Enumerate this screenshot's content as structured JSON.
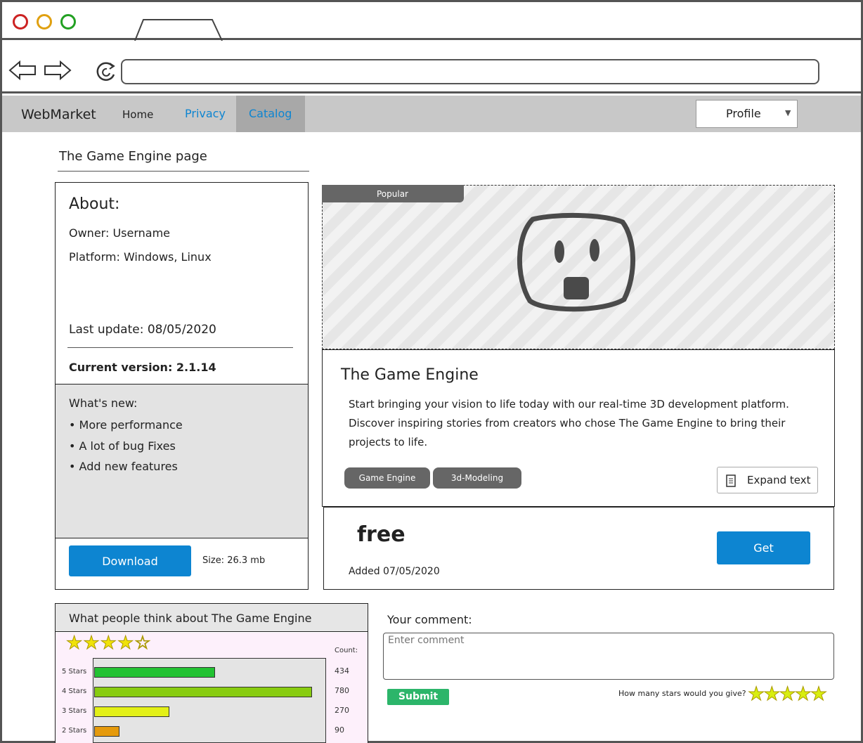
{
  "nav": {
    "brand": "WebMarket",
    "home": "Home",
    "privacy": "Privacy",
    "catalog": "Catalog",
    "profile": "Profile"
  },
  "page": {
    "heading": "The Game Engine page"
  },
  "about": {
    "title": "About:",
    "owner": "Owner: Username",
    "platform": "Platform: Windows, Linux",
    "last_update": "Last update: 08/05/2020",
    "current_version": "Current version: 2.1.14",
    "whats_new_title": "What's new:",
    "whats_new": [
      "• More performance",
      "• A lot of bug Fixes",
      "• Add new features"
    ],
    "download_label": "Download",
    "size": "Size: 26.3 mb"
  },
  "product": {
    "badge": "Popular",
    "title": "The Game Engine",
    "description": [
      "Start bringing your vision to life today with our real-time 3D development platform.",
      "Discover inspiring stories from creators who chose The Game Engine to bring their",
      "projects to life."
    ],
    "tags": [
      "Game Engine",
      "3d-Modeling"
    ],
    "expand_label": "Expand text",
    "price": "free",
    "added": "Added 07/05/2020",
    "get_label": "Get"
  },
  "reviews": {
    "title": "What people think about The Game Engine",
    "average_stars": 4,
    "count_header": "Count:",
    "rows": [
      {
        "label": "5 Stars",
        "count": 434,
        "color": "#22c232"
      },
      {
        "label": "4 Stars",
        "count": 780,
        "color": "#88cc10"
      },
      {
        "label": "3 Stars",
        "count": 270,
        "color": "#e3f018"
      },
      {
        "label": "2 Stars",
        "count": 90,
        "color": "#e59a0c"
      }
    ]
  },
  "comment": {
    "title": "Your comment:",
    "placeholder": "Enter comment",
    "submit_label": "Submit",
    "stars_prompt": "How many stars would you give?",
    "selected_stars": 5
  },
  "colors": {
    "accent_blue": "#0d85d1",
    "submit_green": "#2cb56a",
    "nav_bg": "#c8c8c8"
  }
}
